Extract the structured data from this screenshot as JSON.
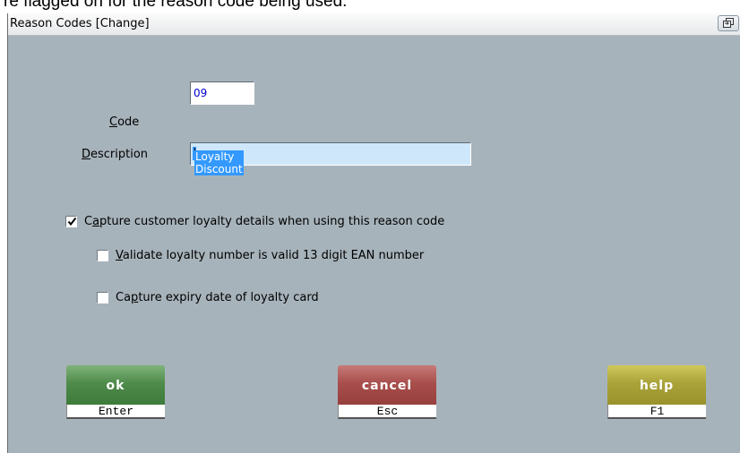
{
  "background_text": "re flagged on for the reason code being used.",
  "window": {
    "title": "Reason Codes  [Change]",
    "restore_icon": "restore-icon"
  },
  "form": {
    "code": {
      "label_hotkey": "C",
      "label_rest": "ode",
      "value": "09"
    },
    "description": {
      "label_hotkey": "D",
      "label_rest": "escription",
      "value": "Loyalty Discount"
    }
  },
  "options": {
    "capture_loyalty": {
      "checked": true,
      "label_pre": "C",
      "label_hotkey": "a",
      "label_rest": "pture customer loyalty details when using this reason code"
    },
    "validate_ean": {
      "checked": false,
      "label_pre": "",
      "label_hotkey": "V",
      "label_rest": "alidate loyalty number is valid 13 digit EAN number"
    },
    "capture_expiry": {
      "checked": false,
      "label_pre": "Ca",
      "label_hotkey": "p",
      "label_rest": "ture expiry date of loyalty card"
    }
  },
  "buttons": {
    "ok": {
      "label": "ok",
      "key": "Enter",
      "color": "#4f8b4b"
    },
    "cancel": {
      "label": "cancel",
      "key": "Esc",
      "color": "#a84f4c"
    },
    "help": {
      "label": "help",
      "key": "F1",
      "color": "#aaa33a"
    }
  },
  "colors": {
    "dialog_background": "#a7b3bb",
    "selection": "#3399ff",
    "code_text": "#0000cc"
  }
}
